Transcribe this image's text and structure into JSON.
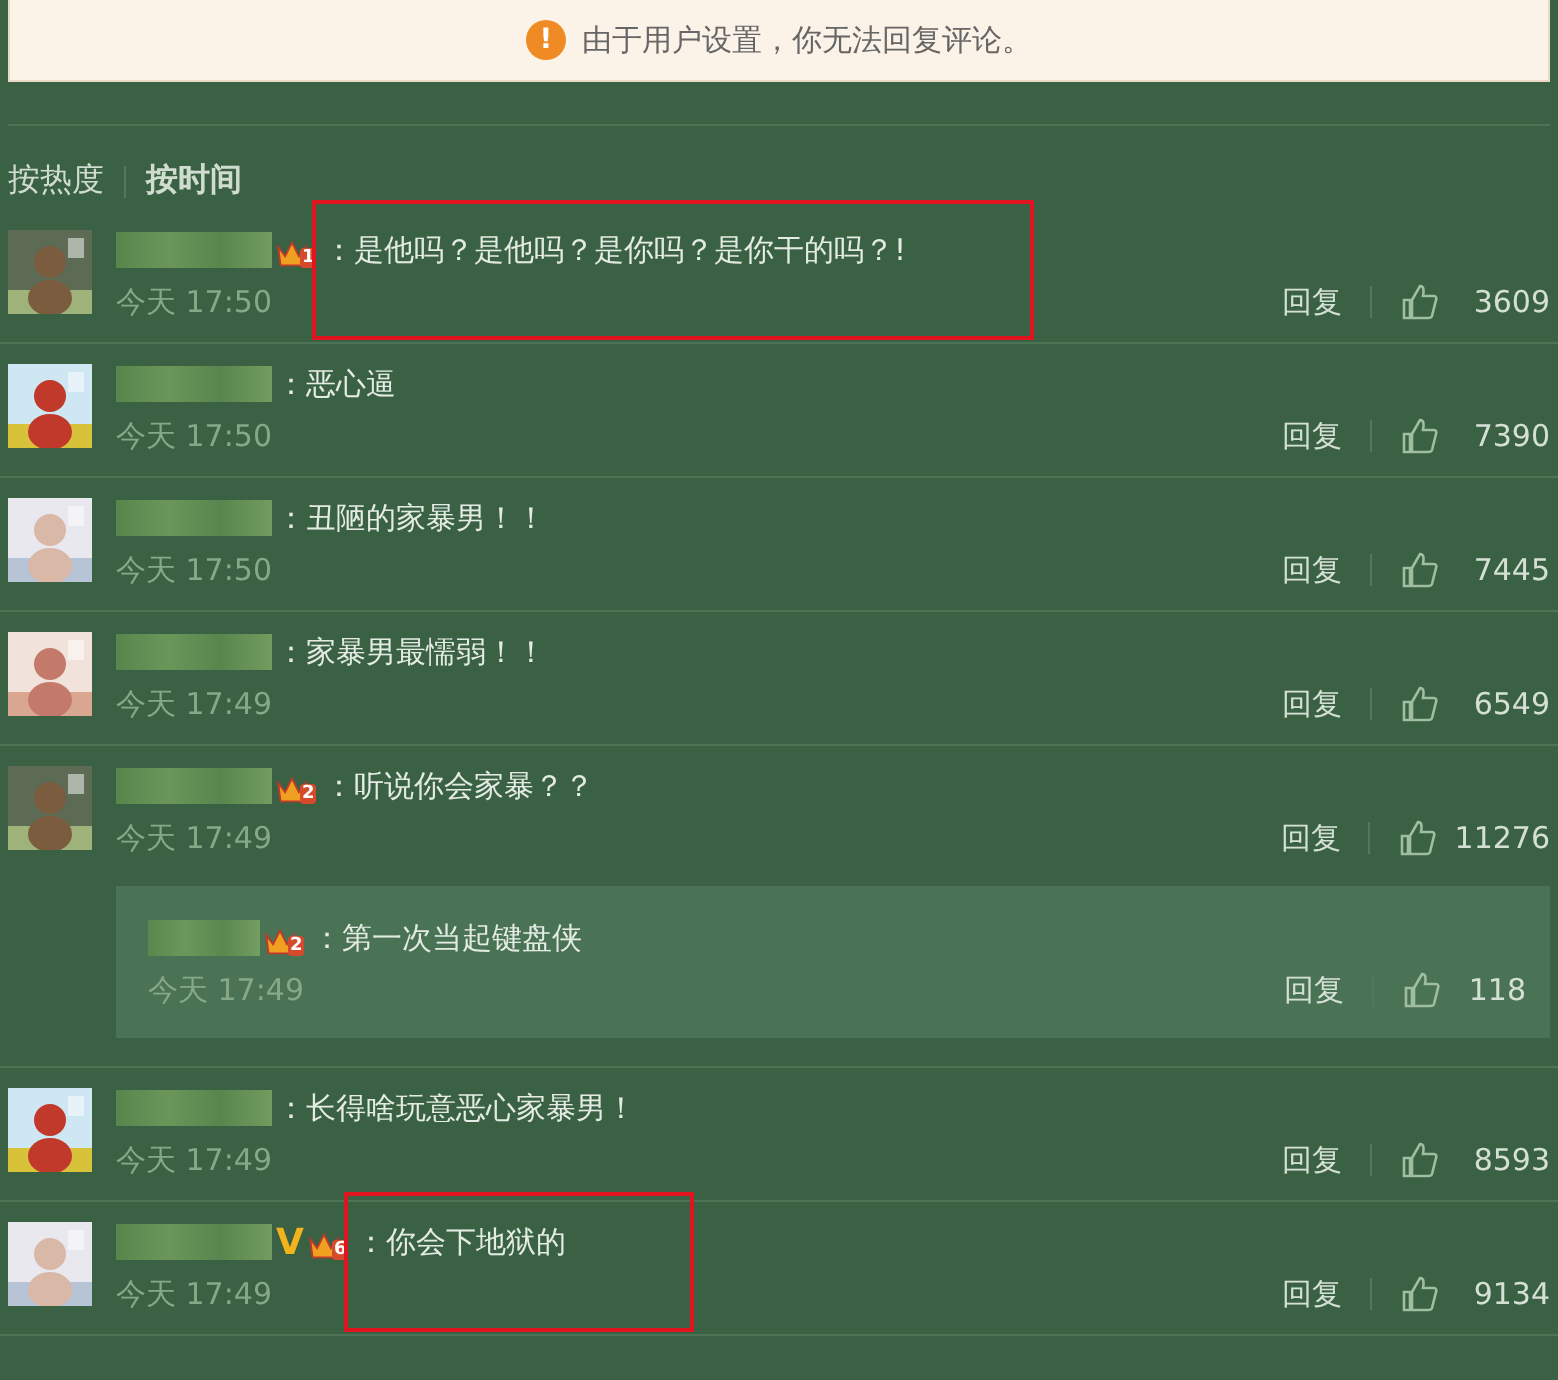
{
  "notice": {
    "icon": "!",
    "text": "由于用户设置，你无法回复评论。"
  },
  "sort_tabs": [
    {
      "label": "按热度",
      "selected": false
    },
    {
      "label": "按时间",
      "selected": true
    }
  ],
  "comments": [
    {
      "name_blurred": true,
      "badge": "1",
      "text": "：是他吗？是他吗？是你吗？是你干的吗？!",
      "time": "今天 17:50",
      "reply": "回复",
      "likes": "3609",
      "highlighted": true,
      "avatar": {
        "kind": "picture"
      }
    },
    {
      "name_blurred": true,
      "text": "：恶心逼",
      "time": "今天 17:50",
      "reply": "回复",
      "likes": "7390",
      "highlighted": false,
      "avatar": {
        "kind": "picture"
      }
    },
    {
      "name_blurred": true,
      "text": "：丑陋的家暴男！！",
      "time": "今天 17:50",
      "reply": "回复",
      "likes": "7445",
      "highlighted": false,
      "avatar": {
        "kind": "picture"
      }
    },
    {
      "name_blurred": true,
      "text": "：家暴男最懦弱！！",
      "time": "今天 17:49",
      "reply": "回复",
      "likes": "6549",
      "highlighted": false,
      "avatar": {
        "kind": "picture"
      }
    },
    {
      "name_blurred": true,
      "badge": "2",
      "text": "：听说你会家暴？？",
      "time": "今天 17:49",
      "reply": "回复",
      "likes": "11276",
      "highlighted": false,
      "avatar": {
        "kind": "picture"
      },
      "replies": [
        {
          "name_blurred": true,
          "badge": "2",
          "text": "：第一次当起键盘侠",
          "time": "今天 17:49",
          "reply": "回复",
          "likes": "118"
        }
      ]
    },
    {
      "name_blurred": true,
      "text": "：长得啥玩意恶心家暴男！",
      "time": "今天 17:49",
      "reply": "回复",
      "likes": "8593",
      "highlighted": false,
      "avatar": {
        "kind": "picture"
      }
    },
    {
      "name_blurred": true,
      "verified": "V",
      "badge": "6",
      "text": "：你会下地狱的",
      "time": "今天 17:49",
      "reply": "回复",
      "likes": "9134",
      "highlighted": true,
      "avatar": {
        "kind": "picture"
      }
    }
  ]
}
